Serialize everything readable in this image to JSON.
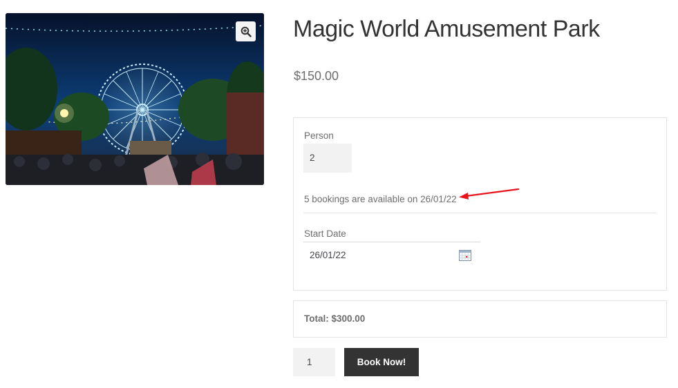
{
  "product": {
    "image_alt": "Ferris wheel at night in an amusement park",
    "title": "Magic World Amusement Park",
    "price": "$150.00"
  },
  "booking": {
    "person_label": "Person",
    "person_value": "2",
    "availability": "5 bookings are available on 26/01/22",
    "start_date_label": "Start Date",
    "start_date_value": "26/01/22"
  },
  "total": {
    "text": "Total: $300.00"
  },
  "cart": {
    "quantity": "1",
    "button_label": "Book Now!"
  },
  "icons": {
    "zoom": "zoom-in-icon",
    "calendar": "calendar-icon"
  },
  "colors": {
    "button_bg": "#333333",
    "annotation": "#e8141b",
    "input_bg": "#f2f2f2"
  }
}
